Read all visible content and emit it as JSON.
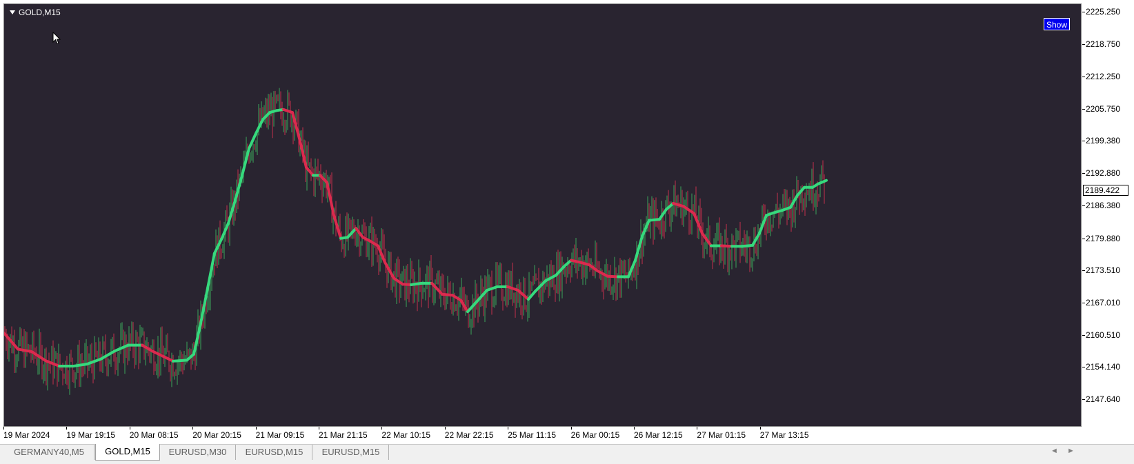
{
  "window": {
    "symbol": "GOLD,M15"
  },
  "buttons": {
    "show": "Show"
  },
  "colors": {
    "background": "#292430",
    "up_line": "#36d97d",
    "down_line": "#dc2a4e",
    "candle_up": "#3aa55a",
    "candle_down": "#c4304c"
  },
  "price_axis": {
    "labels": [
      "2225.250",
      "2218.750",
      "2212.250",
      "2205.750",
      "2199.380",
      "2192.880",
      "2186.380",
      "2179.880",
      "2173.510",
      "2167.010",
      "2160.510",
      "2154.140",
      "2147.640"
    ],
    "current_price": "2189.422"
  },
  "time_axis": {
    "labels": [
      "19 Mar 2024",
      "19 Mar 19:15",
      "20 Mar 08:15",
      "20 Mar 20:15",
      "21 Mar 09:15",
      "21 Mar 21:15",
      "22 Mar 10:15",
      "22 Mar 22:15",
      "25 Mar 11:15",
      "26 Mar 00:15",
      "26 Mar 12:15",
      "27 Mar 01:15",
      "27 Mar 13:15"
    ]
  },
  "tabs": [
    {
      "label": "GERMANY40,M5",
      "active": false
    },
    {
      "label": "GOLD,M15",
      "active": true
    },
    {
      "label": "EURUSD,M30",
      "active": false
    },
    {
      "label": "EURUSD,M15",
      "active": false
    },
    {
      "label": "EURUSD,M15",
      "active": false
    }
  ],
  "chart_data": {
    "type": "line",
    "title": "GOLD,M15",
    "x": [
      "19 Mar 2024",
      "19 Mar 19:15",
      "20 Mar 08:15",
      "20 Mar 20:15",
      "21 Mar 09:15",
      "21 Mar 21:15",
      "22 Mar 10:15",
      "22 Mar 22:15",
      "25 Mar 11:15",
      "26 Mar 00:15",
      "26 Mar 12:15",
      "27 Mar 01:15",
      "27 Mar 13:15"
    ],
    "ylim": [
      2147.64,
      2225.25
    ],
    "grid": false,
    "series": [
      {
        "values": [
          [
            0,
            2161.0
          ],
          [
            20,
            2157.8
          ],
          [
            40,
            2157.3
          ],
          [
            60,
            2155.5
          ],
          [
            80,
            2154.4
          ],
          [
            100,
            2154.4
          ],
          [
            120,
            2154.8
          ],
          [
            140,
            2155.8
          ],
          [
            160,
            2157.4
          ],
          [
            180,
            2158.6
          ],
          [
            200,
            2158.6
          ],
          [
            215,
            2157.4
          ],
          [
            230,
            2156.4
          ],
          [
            245,
            2155.4
          ],
          [
            265,
            2155.6
          ],
          [
            275,
            2156.8
          ],
          [
            285,
            2163.0
          ],
          [
            295,
            2170.0
          ],
          [
            305,
            2177.0
          ],
          [
            315,
            2179.8
          ],
          [
            325,
            2183.0
          ],
          [
            335,
            2187.6
          ],
          [
            345,
            2192.6
          ],
          [
            355,
            2198.0
          ],
          [
            365,
            2201.0
          ],
          [
            375,
            2203.8
          ],
          [
            385,
            2205.2
          ],
          [
            395,
            2205.6
          ],
          [
            405,
            2205.8
          ],
          [
            418,
            2205.2
          ],
          [
            428,
            2200.0
          ],
          [
            438,
            2194.2
          ],
          [
            448,
            2192.6
          ],
          [
            458,
            2192.6
          ],
          [
            468,
            2191.2
          ],
          [
            478,
            2184.6
          ],
          [
            488,
            2180.0
          ],
          [
            498,
            2180.2
          ],
          [
            510,
            2182.0
          ],
          [
            520,
            2180.2
          ],
          [
            530,
            2179.5
          ],
          [
            542,
            2178.5
          ],
          [
            552,
            2175.2
          ],
          [
            565,
            2172.0
          ],
          [
            578,
            2170.8
          ],
          [
            590,
            2170.7
          ],
          [
            605,
            2171.0
          ],
          [
            620,
            2171.0
          ],
          [
            635,
            2168.8
          ],
          [
            650,
            2168.6
          ],
          [
            662,
            2167.6
          ],
          [
            672,
            2165.3
          ],
          [
            685,
            2167.3
          ],
          [
            700,
            2169.6
          ],
          [
            715,
            2170.3
          ],
          [
            730,
            2170.3
          ],
          [
            745,
            2169.6
          ],
          [
            760,
            2167.8
          ],
          [
            770,
            2169.4
          ],
          [
            785,
            2171.5
          ],
          [
            800,
            2172.6
          ],
          [
            812,
            2174.4
          ],
          [
            822,
            2175.6
          ],
          [
            835,
            2175.2
          ],
          [
            848,
            2174.7
          ],
          [
            860,
            2173.5
          ],
          [
            875,
            2172.4
          ],
          [
            890,
            2172.3
          ],
          [
            905,
            2172.3
          ],
          [
            915,
            2175.6
          ],
          [
            925,
            2180.4
          ],
          [
            935,
            2183.6
          ],
          [
            950,
            2183.8
          ],
          [
            960,
            2185.8
          ],
          [
            970,
            2187.0
          ],
          [
            985,
            2186.4
          ],
          [
            1000,
            2185.0
          ],
          [
            1012,
            2181.0
          ],
          [
            1025,
            2178.5
          ],
          [
            1040,
            2178.5
          ],
          [
            1055,
            2178.4
          ],
          [
            1070,
            2178.4
          ],
          [
            1085,
            2178.6
          ],
          [
            1095,
            2181.0
          ],
          [
            1105,
            2184.6
          ],
          [
            1115,
            2185.1
          ],
          [
            1128,
            2185.6
          ],
          [
            1140,
            2186.2
          ],
          [
            1150,
            2188.6
          ],
          [
            1160,
            2190.2
          ],
          [
            1172,
            2190.2
          ],
          [
            1180,
            2190.9
          ],
          [
            1192,
            2191.6
          ]
        ]
      }
    ]
  }
}
